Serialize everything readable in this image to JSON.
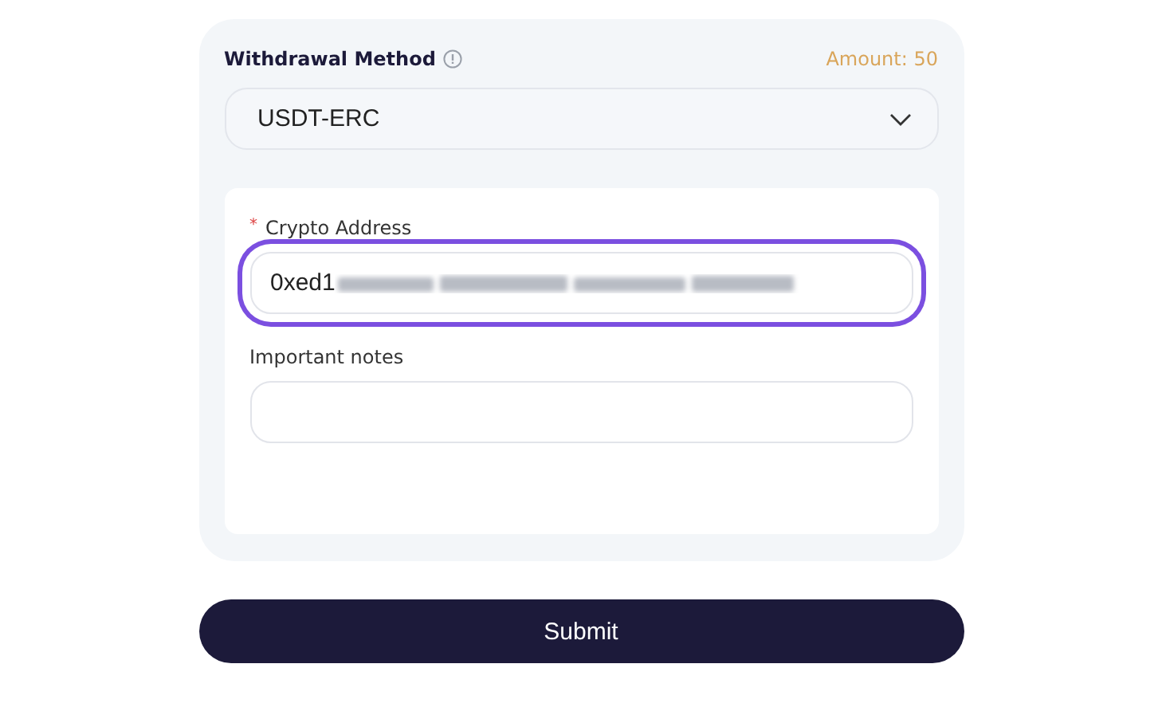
{
  "withdrawal_method": {
    "label": "Withdrawal Method",
    "amount": "Amount: 50",
    "selected_value": "USDT-ERC"
  },
  "fields": [
    {
      "label": "Crypto Address",
      "required": true,
      "required_mark": "*",
      "value": "0xed1",
      "focused": true,
      "redacted": true
    },
    {
      "label": "Important notes",
      "required": false,
      "focused": false,
      "redacted": false
    }
  ],
  "submit": "Submit"
}
